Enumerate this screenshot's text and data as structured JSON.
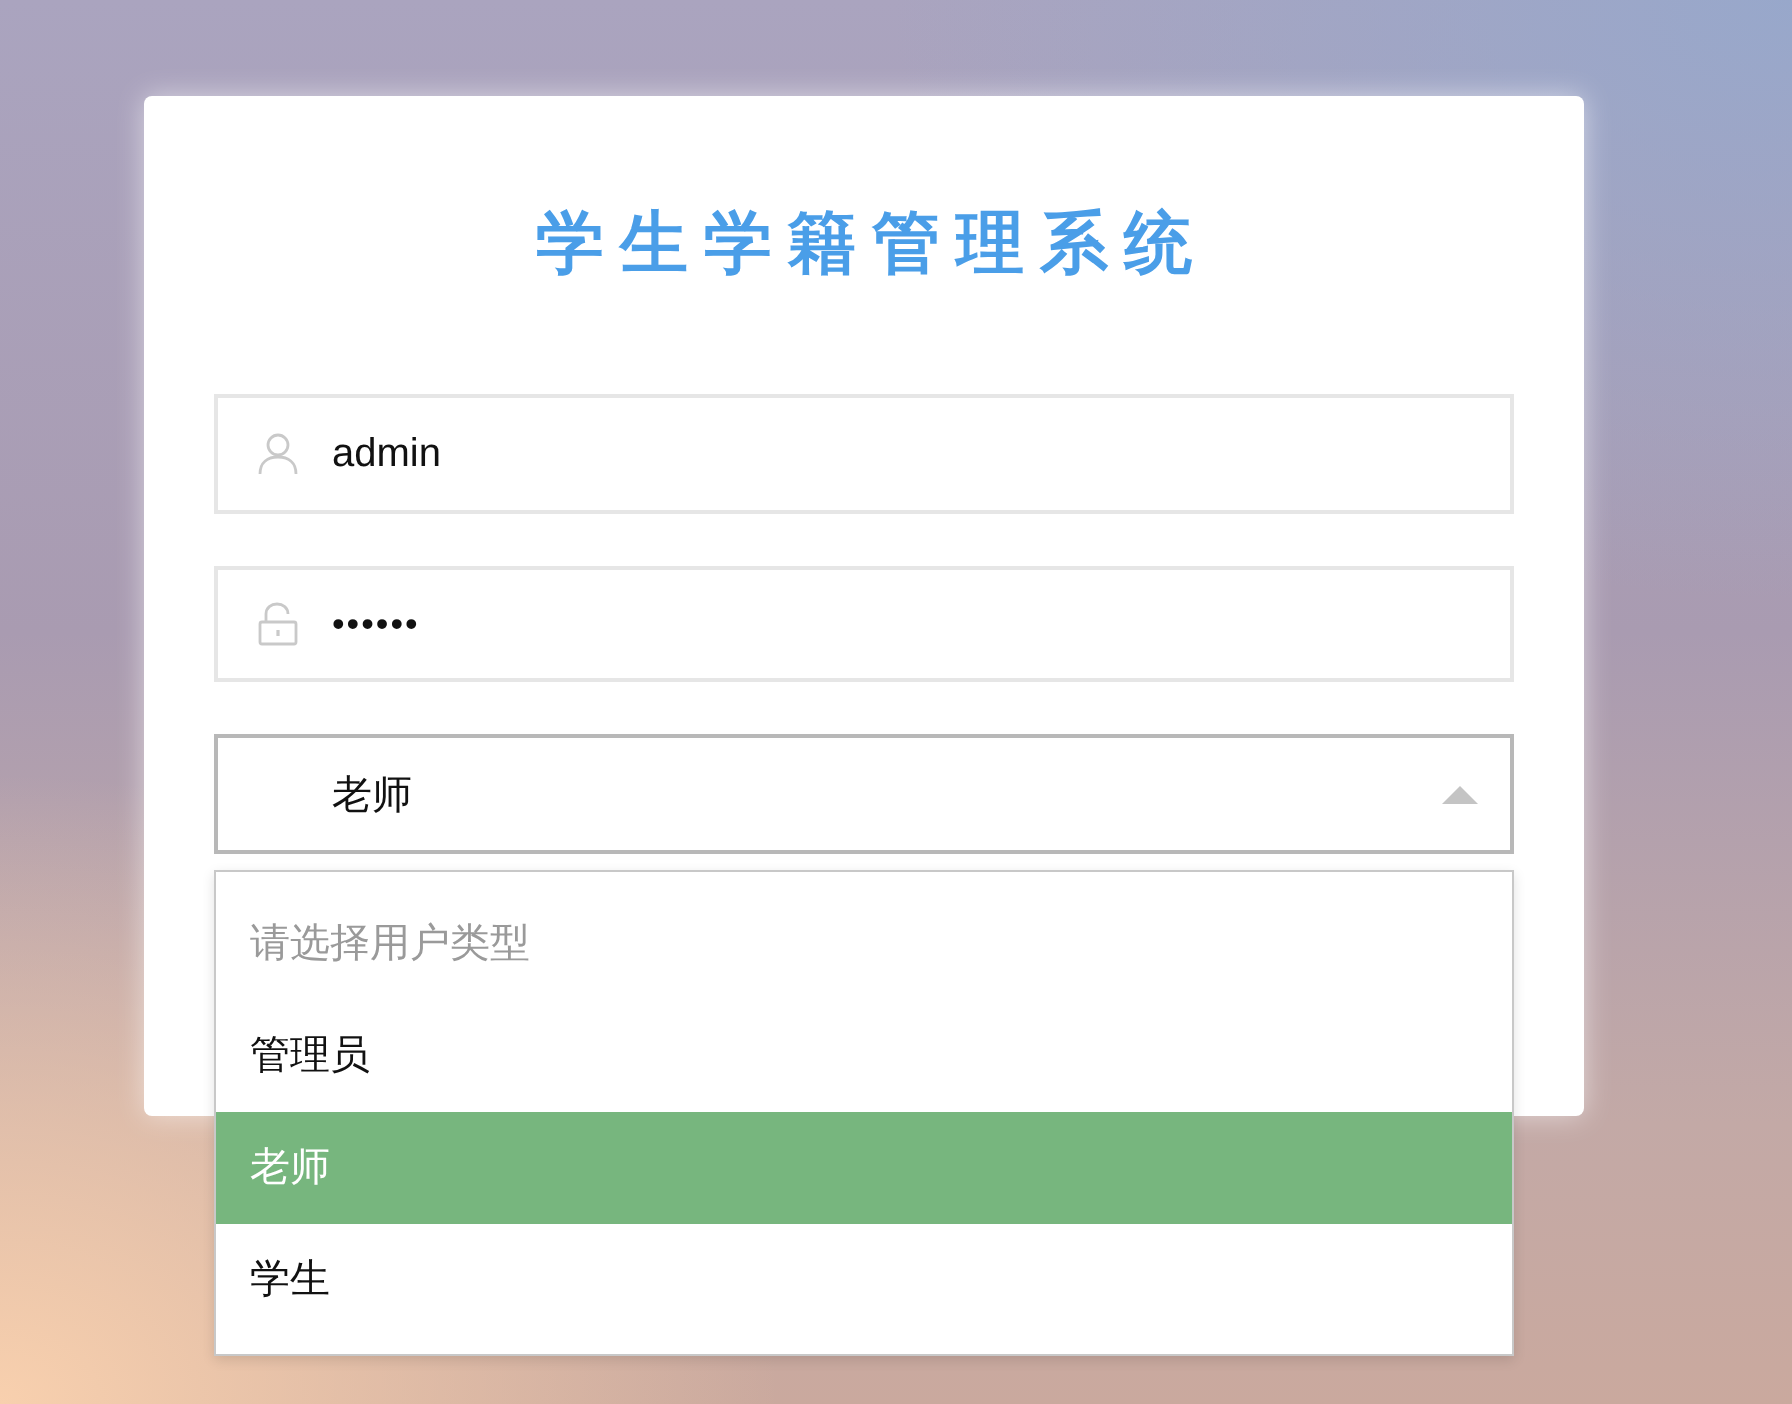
{
  "title": "学生学籍管理系统",
  "form": {
    "username": {
      "value": "admin"
    },
    "password": {
      "value": "••••••"
    },
    "user_type": {
      "value": "老师",
      "expanded": true
    }
  },
  "dropdown": {
    "options": [
      {
        "label": "请选择用户类型",
        "selected": false,
        "disabled": true
      },
      {
        "label": "管理员",
        "selected": false,
        "disabled": false
      },
      {
        "label": "老师",
        "selected": true,
        "disabled": false
      },
      {
        "label": "学生",
        "selected": false,
        "disabled": false
      }
    ]
  }
}
